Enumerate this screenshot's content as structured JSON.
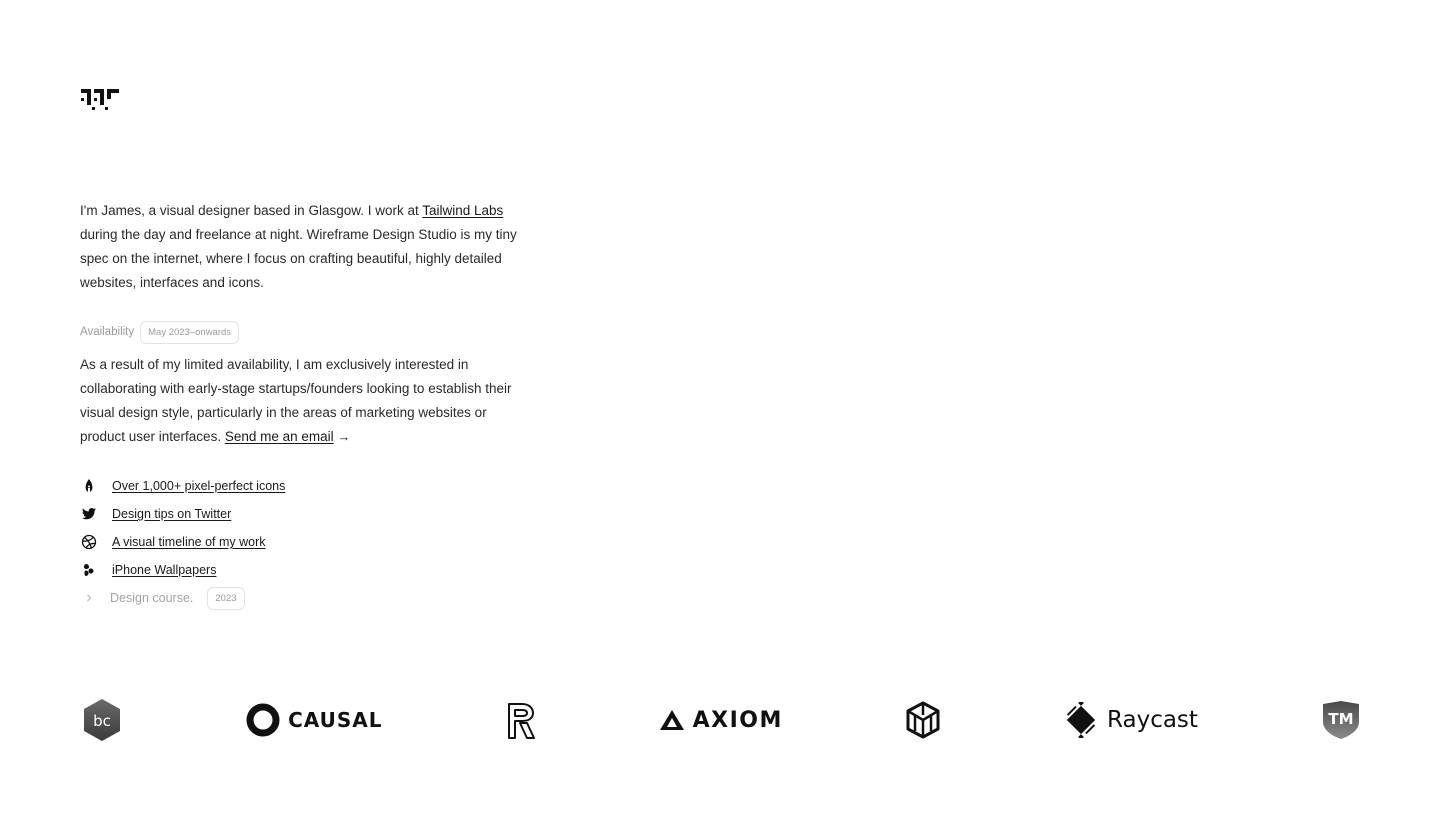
{
  "logo": {
    "name": "Wireframe Design Studio logo"
  },
  "intro": {
    "text_before": "I'm James, a visual designer based in Glasgow. I work at ",
    "link": "Tailwind Labs",
    "text_after": " during the day and freelance at night. Wireframe Design Studio is my tiny spec on the internet, where I focus on crafting beautiful, highly detailed websites, interfaces and icons."
  },
  "availability": {
    "label": "Availability",
    "badge": "May 2023–onwards",
    "text": "As a result of my limited availability, I am exclusively interested in collaborating with early-stage startups/founders looking to establish their visual design style, particularly in the areas of marketing websites or product user interfaces. ",
    "email_link": "Send me an email",
    "arrow": "→"
  },
  "links": [
    {
      "icon": "pen-nib-icon",
      "label": "Over 1,000+ pixel-perfect icons"
    },
    {
      "icon": "twitter-icon",
      "label": "Design tips on Twitter"
    },
    {
      "icon": "dribbble-icon",
      "label": "A visual timeline of my work"
    },
    {
      "icon": "leaf-icon",
      "label": "iPhone Wallpapers"
    }
  ],
  "course": {
    "icon": "chevron-right-icon",
    "label": "Design course.",
    "badge": "2023"
  },
  "brands": [
    {
      "name": "bc-logo",
      "text": "bc"
    },
    {
      "name": "causal-logo",
      "text": "CAUSAL"
    },
    {
      "name": "r-logo",
      "text": ""
    },
    {
      "name": "axiom-logo",
      "text": "AXIOM"
    },
    {
      "name": "cube-logo",
      "text": ""
    },
    {
      "name": "raycast-logo",
      "text": "Raycast"
    },
    {
      "name": "tm-logo",
      "text": "TM"
    }
  ]
}
